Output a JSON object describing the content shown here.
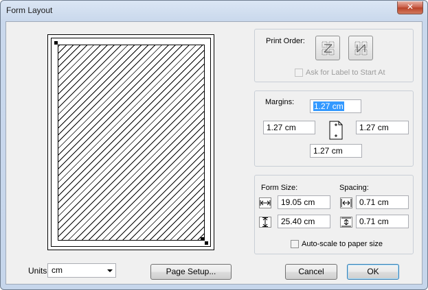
{
  "window": {
    "title": "Form Layout",
    "close_glyph": "✕"
  },
  "print_order": {
    "label": "Print Order:",
    "across_icon": "print-order-across-icon",
    "down_icon": "print-order-down-icon",
    "ask_label": "Ask for Label to Start At",
    "ask_checked": false,
    "ask_enabled": false
  },
  "margins": {
    "label": "Margins:",
    "top": "1.27 cm",
    "left": "1.27 cm",
    "right": "1.27 cm",
    "bottom": "1.27 cm",
    "page_icon": "page-margins-icon"
  },
  "form_size": {
    "label": "Form Size:",
    "width": "19.05 cm",
    "height": "25.40 cm"
  },
  "spacing": {
    "label": "Spacing:",
    "horizontal": "0.71 cm",
    "vertical": "0.71 cm"
  },
  "auto_scale": {
    "label": "Auto-scale to paper size",
    "checked": false
  },
  "units": {
    "label": "Units:",
    "value": "cm"
  },
  "buttons": {
    "page_setup": "Page Setup...",
    "cancel": "Cancel",
    "ok": "OK"
  }
}
